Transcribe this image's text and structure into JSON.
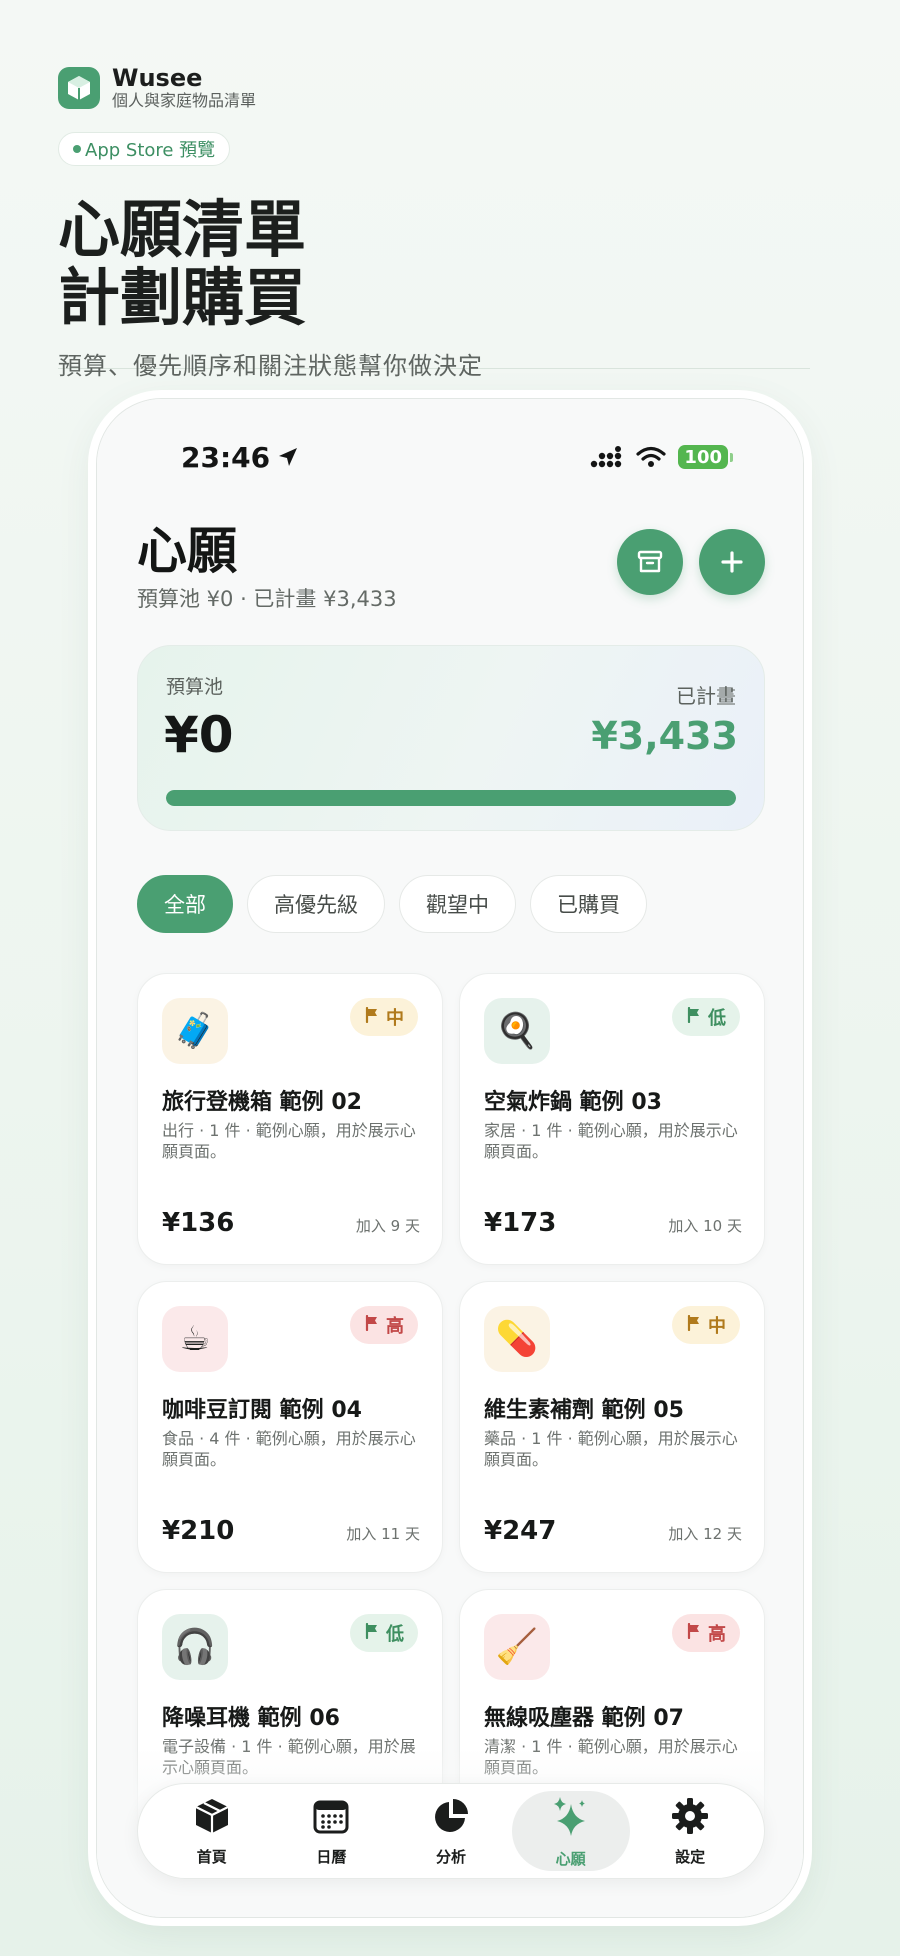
{
  "brand": {
    "name": "Wusee",
    "subtitle": "個人與家庭物品清單",
    "badge": "App Store 預覽"
  },
  "hero": {
    "headline_line1": "心願清單",
    "headline_line2": "計劃購買",
    "tagline": "預算、優先順序和關注狀態幫你做決定"
  },
  "status_bar": {
    "time": "23:46",
    "battery": "100"
  },
  "header": {
    "title": "心願",
    "subtitle": "預算池 ¥0 · 已計畫 ¥3,433"
  },
  "budget": {
    "pool_label": "預算池",
    "pool_value": "¥0",
    "planned_label": "已計畫",
    "planned_value": "¥3,433",
    "progress_fraction": 1.0
  },
  "filters": [
    {
      "label": "全部",
      "active": true
    },
    {
      "label": "高優先級",
      "active": false
    },
    {
      "label": "觀望中",
      "active": false
    },
    {
      "label": "已購買",
      "active": false
    }
  ],
  "items": [
    {
      "emoji": "🧳",
      "icon": "luggage-icon",
      "tint": "#fbf3e4",
      "priority": "中",
      "level": "mid",
      "title": "旅行登機箱 範例 02",
      "desc": "出行 · 1 件 · 範例心願，用於展示心願頁面。",
      "price": "¥136",
      "added": "加入 9 天"
    },
    {
      "emoji": "🍳",
      "icon": "frying-pan-icon",
      "tint": "#e6f2ec",
      "priority": "低",
      "level": "low",
      "title": "空氣炸鍋 範例 03",
      "desc": "家居 · 1 件 · 範例心願，用於展示心願頁面。",
      "price": "¥173",
      "added": "加入 10 天"
    },
    {
      "emoji": "☕",
      "icon": "coffee-icon",
      "tint": "#fbe9ea",
      "priority": "高",
      "level": "high",
      "title": "咖啡豆訂閱 範例 04",
      "desc": "食品 · 4 件 · 範例心願，用於展示心願頁面。",
      "price": "¥210",
      "added": "加入 11 天"
    },
    {
      "emoji": "💊",
      "icon": "pill-icon",
      "tint": "#fbf3e4",
      "priority": "中",
      "level": "mid",
      "title": "維生素補劑 範例 05",
      "desc": "藥品 · 1 件 · 範例心願，用於展示心願頁面。",
      "price": "¥247",
      "added": "加入 12 天"
    },
    {
      "emoji": "🎧",
      "icon": "headphones-icon",
      "tint": "#e6f2ec",
      "priority": "低",
      "level": "low",
      "title": "降噪耳機 範例 06",
      "desc": "電子設備 · 1 件 · 範例心願，用於展示心願頁面。",
      "price": "",
      "added": ""
    },
    {
      "emoji": "🧹",
      "icon": "broom-icon",
      "tint": "#fbe9ea",
      "priority": "高",
      "level": "high",
      "title": "無線吸塵器 範例 07",
      "desc": "清潔 · 1 件 · 範例心願，用於展示心願頁面。",
      "price": "",
      "added": ""
    }
  ],
  "tabs": [
    {
      "label": "首頁",
      "icon": "box-icon",
      "active": false
    },
    {
      "label": "日曆",
      "icon": "calendar-icon",
      "active": false
    },
    {
      "label": "分析",
      "icon": "pie-chart-icon",
      "active": false
    },
    {
      "label": "心願",
      "icon": "sparkles-icon",
      "active": true
    },
    {
      "label": "設定",
      "icon": "gear-icon",
      "active": false
    }
  ],
  "colors": {
    "accent": "#4a9f72",
    "priority_mid": "#b07a1c",
    "priority_low": "#3e8f60",
    "priority_high": "#c24848"
  }
}
